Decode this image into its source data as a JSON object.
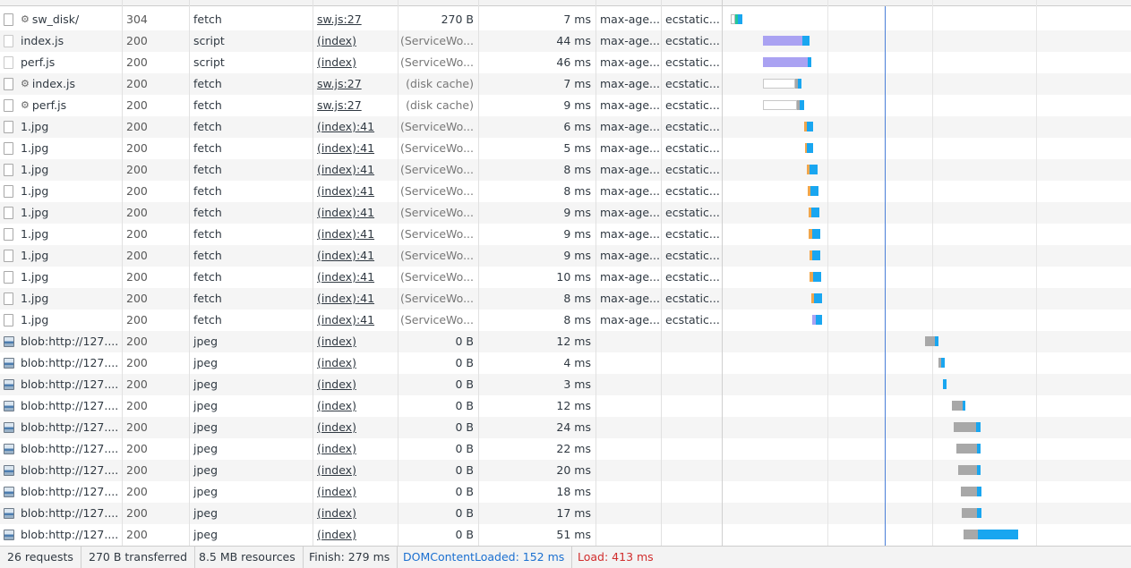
{
  "rows": [
    {
      "name": "sw_disk/",
      "icon": "gear",
      "status": "304",
      "type": "fetch",
      "initiator": "sw.js:27",
      "size": "270 B",
      "time": "7 ms",
      "cache": "max-age...",
      "server": "ecstatic..."
    },
    {
      "name": "index.js",
      "icon": "js",
      "status": "200",
      "type": "script",
      "initiator": "(index)",
      "size": "(ServiceWo...",
      "time": "44 ms",
      "cache": "max-age...",
      "server": "ecstatic..."
    },
    {
      "name": "perf.js",
      "icon": "js",
      "status": "200",
      "type": "script",
      "initiator": "(index)",
      "size": "(ServiceWo...",
      "time": "46 ms",
      "cache": "max-age...",
      "server": "ecstatic..."
    },
    {
      "name": "index.js",
      "icon": "gear",
      "status": "200",
      "type": "fetch",
      "initiator": "sw.js:27",
      "size": "(disk cache)",
      "time": "7 ms",
      "cache": "max-age...",
      "server": "ecstatic..."
    },
    {
      "name": "perf.js",
      "icon": "gear",
      "status": "200",
      "type": "fetch",
      "initiator": "sw.js:27",
      "size": "(disk cache)",
      "time": "9 ms",
      "cache": "max-age...",
      "server": "ecstatic..."
    },
    {
      "name": "1.jpg",
      "icon": "file",
      "status": "200",
      "type": "fetch",
      "initiator": "(index):41",
      "size": "(ServiceWo...",
      "time": "6 ms",
      "cache": "max-age...",
      "server": "ecstatic..."
    },
    {
      "name": "1.jpg",
      "icon": "file",
      "status": "200",
      "type": "fetch",
      "initiator": "(index):41",
      "size": "(ServiceWo...",
      "time": "5 ms",
      "cache": "max-age...",
      "server": "ecstatic..."
    },
    {
      "name": "1.jpg",
      "icon": "file",
      "status": "200",
      "type": "fetch",
      "initiator": "(index):41",
      "size": "(ServiceWo...",
      "time": "8 ms",
      "cache": "max-age...",
      "server": "ecstatic..."
    },
    {
      "name": "1.jpg",
      "icon": "file",
      "status": "200",
      "type": "fetch",
      "initiator": "(index):41",
      "size": "(ServiceWo...",
      "time": "8 ms",
      "cache": "max-age...",
      "server": "ecstatic..."
    },
    {
      "name": "1.jpg",
      "icon": "file",
      "status": "200",
      "type": "fetch",
      "initiator": "(index):41",
      "size": "(ServiceWo...",
      "time": "9 ms",
      "cache": "max-age...",
      "server": "ecstatic..."
    },
    {
      "name": "1.jpg",
      "icon": "file",
      "status": "200",
      "type": "fetch",
      "initiator": "(index):41",
      "size": "(ServiceWo...",
      "time": "9 ms",
      "cache": "max-age...",
      "server": "ecstatic..."
    },
    {
      "name": "1.jpg",
      "icon": "file",
      "status": "200",
      "type": "fetch",
      "initiator": "(index):41",
      "size": "(ServiceWo...",
      "time": "9 ms",
      "cache": "max-age...",
      "server": "ecstatic..."
    },
    {
      "name": "1.jpg",
      "icon": "file",
      "status": "200",
      "type": "fetch",
      "initiator": "(index):41",
      "size": "(ServiceWo...",
      "time": "10 ms",
      "cache": "max-age...",
      "server": "ecstatic..."
    },
    {
      "name": "1.jpg",
      "icon": "file",
      "status": "200",
      "type": "fetch",
      "initiator": "(index):41",
      "size": "(ServiceWo...",
      "time": "8 ms",
      "cache": "max-age...",
      "server": "ecstatic..."
    },
    {
      "name": "1.jpg",
      "icon": "file",
      "status": "200",
      "type": "fetch",
      "initiator": "(index):41",
      "size": "(ServiceWo...",
      "time": "8 ms",
      "cache": "max-age...",
      "server": "ecstatic..."
    },
    {
      "name": "blob:http://127....",
      "icon": "img",
      "status": "200",
      "type": "jpeg",
      "initiator": "(index)",
      "size": "0 B",
      "time": "12 ms",
      "cache": "",
      "server": ""
    },
    {
      "name": "blob:http://127....",
      "icon": "img",
      "status": "200",
      "type": "jpeg",
      "initiator": "(index)",
      "size": "0 B",
      "time": "4 ms",
      "cache": "",
      "server": ""
    },
    {
      "name": "blob:http://127....",
      "icon": "img",
      "status": "200",
      "type": "jpeg",
      "initiator": "(index)",
      "size": "0 B",
      "time": "3 ms",
      "cache": "",
      "server": ""
    },
    {
      "name": "blob:http://127....",
      "icon": "img",
      "status": "200",
      "type": "jpeg",
      "initiator": "(index)",
      "size": "0 B",
      "time": "12 ms",
      "cache": "",
      "server": ""
    },
    {
      "name": "blob:http://127....",
      "icon": "img",
      "status": "200",
      "type": "jpeg",
      "initiator": "(index)",
      "size": "0 B",
      "time": "24 ms",
      "cache": "",
      "server": ""
    },
    {
      "name": "blob:http://127....",
      "icon": "img",
      "status": "200",
      "type": "jpeg",
      "initiator": "(index)",
      "size": "0 B",
      "time": "22 ms",
      "cache": "",
      "server": ""
    },
    {
      "name": "blob:http://127....",
      "icon": "img",
      "status": "200",
      "type": "jpeg",
      "initiator": "(index)",
      "size": "0 B",
      "time": "20 ms",
      "cache": "",
      "server": ""
    },
    {
      "name": "blob:http://127....",
      "icon": "img",
      "status": "200",
      "type": "jpeg",
      "initiator": "(index)",
      "size": "0 B",
      "time": "18 ms",
      "cache": "",
      "server": ""
    },
    {
      "name": "blob:http://127....",
      "icon": "img",
      "status": "200",
      "type": "jpeg",
      "initiator": "(index)",
      "size": "0 B",
      "time": "17 ms",
      "cache": "",
      "server": ""
    },
    {
      "name": "blob:http://127....",
      "icon": "img",
      "status": "200",
      "type": "jpeg",
      "initiator": "(index)",
      "size": "0 B",
      "time": "51 ms",
      "cache": "",
      "server": ""
    }
  ],
  "statusbar": {
    "requests": "26 requests",
    "transferred": "270 B transferred",
    "resources": "8.5 MB resources",
    "finish": "Finish: 279 ms",
    "dcl": "DOMContentLoaded: 152 ms",
    "load": "Load: 413 ms"
  },
  "colors": {
    "dcl_line": "#4a7fd8",
    "download_bar": "#19a6f0",
    "service_worker_bar": "#aaa2f2",
    "waiting_bar": "#a8a8a8",
    "load_text": "#d12d2d",
    "dcl_text": "#1a6fd0"
  }
}
